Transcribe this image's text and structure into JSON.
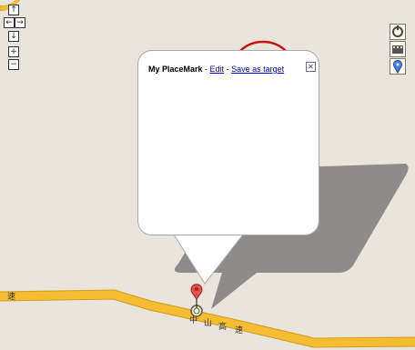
{
  "map": {
    "background": "#e9e5dc",
    "road_color": "#f5bd32",
    "road_labels": [
      "速",
      "中",
      "山",
      "高",
      "速"
    ]
  },
  "nav_controls": {
    "pan_up": "↑",
    "pan_left": "←",
    "pan_right": "→",
    "pan_down": "↓",
    "zoom_in": "+",
    "zoom_out": "−"
  },
  "right_controls": [
    "rotate-icon",
    "film-icon",
    "placemark-icon"
  ],
  "info_window": {
    "title": "My PlaceMark",
    "sep1": " - ",
    "edit_link": "Edit",
    "sep2": " - ",
    "save_link": "Save as target",
    "close": "✕"
  },
  "highlight_color": "#cc1111",
  "marker_color": "#e0514e"
}
